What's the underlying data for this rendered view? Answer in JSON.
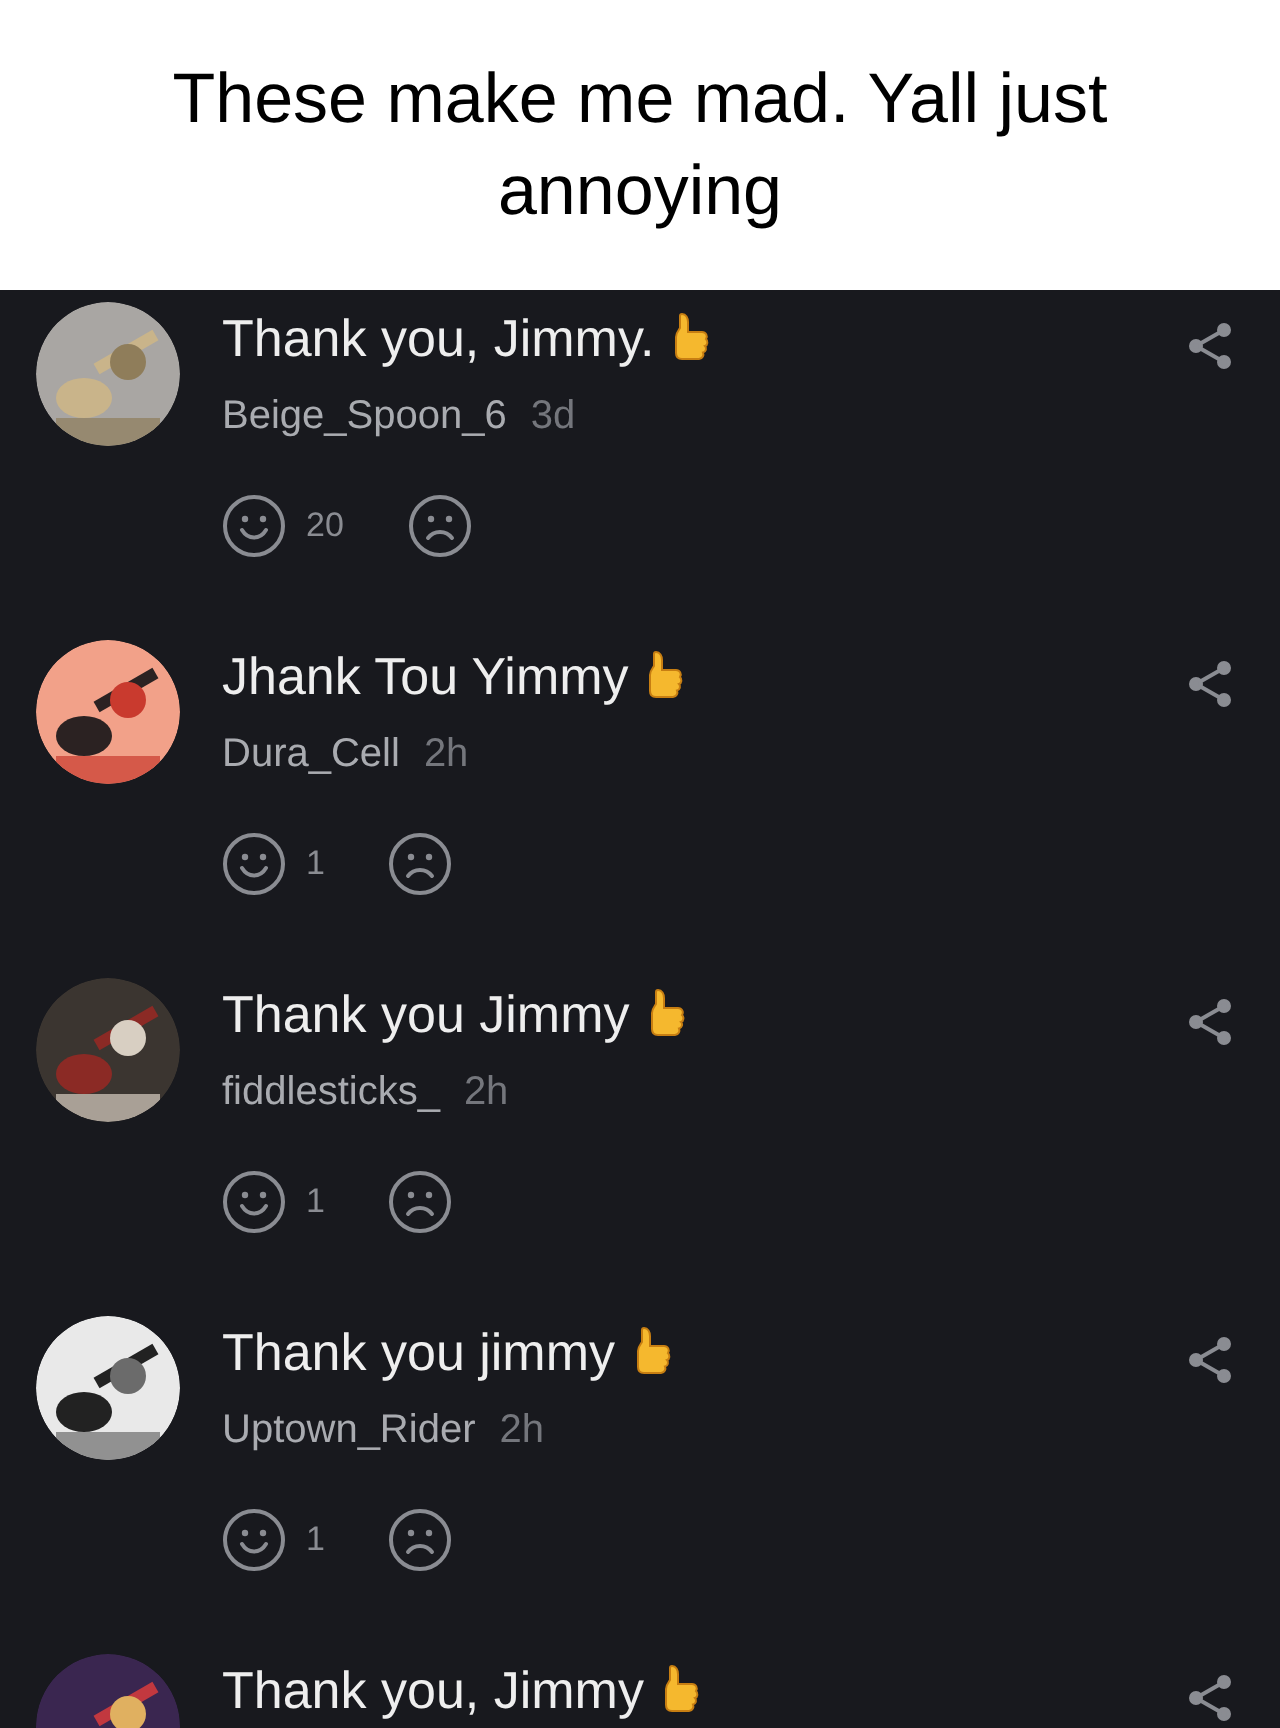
{
  "caption": "These make me mad. Yall just annoying",
  "comments": [
    {
      "text": "Thank you, Jimmy.",
      "username": "Beige_Spoon_6",
      "time": "3d",
      "likes": "20"
    },
    {
      "text": "Jhank Tou Yimmy",
      "username": "Dura_Cell",
      "time": "2h",
      "likes": "1"
    },
    {
      "text": "Thank you Jimmy",
      "username": "fiddlesticks_",
      "time": "2h",
      "likes": "1"
    },
    {
      "text": "Thank you jimmy",
      "username": "Uptown_Rider",
      "time": "2h",
      "likes": "1"
    },
    {
      "text": "Thank you, Jimmy"
    }
  ]
}
